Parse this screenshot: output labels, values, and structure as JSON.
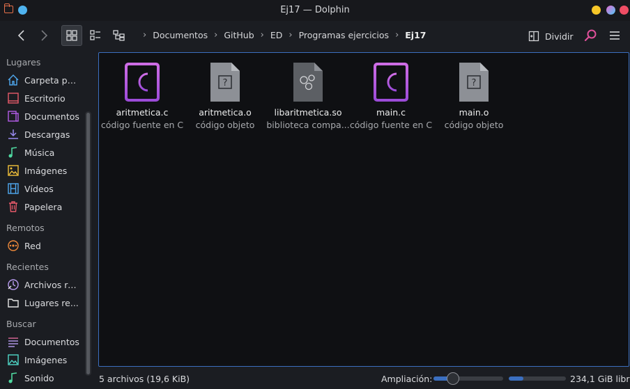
{
  "window": {
    "title": "Ej17 — Dolphin"
  },
  "colors": {
    "accent": "#3b6fc0",
    "c_source_icon": "#c85ce0",
    "folder_icon": "#e5704a"
  },
  "toolbar": {
    "breadcrumb": [
      "Documentos",
      "GitHub",
      "ED",
      "Programas ejercicios",
      "Ej17"
    ],
    "divide_label": "Dividir",
    "icons": [
      "back-arrow-icon",
      "forward-arrow-icon",
      "icons-view-icon",
      "details-view-icon",
      "tree-view-icon",
      "search-icon",
      "hamburger-menu-icon"
    ]
  },
  "sidebar": {
    "sections": [
      {
        "title": "Lugares",
        "items": [
          {
            "label": "Carpeta pe...",
            "icon": "home-icon"
          },
          {
            "label": "Escritorio",
            "icon": "desktop-icon"
          },
          {
            "label": "Documentos",
            "icon": "documents-icon"
          },
          {
            "label": "Descargas",
            "icon": "downloads-icon"
          },
          {
            "label": "Música",
            "icon": "music-icon"
          },
          {
            "label": "Imágenes",
            "icon": "pictures-icon"
          },
          {
            "label": "Vídeos",
            "icon": "videos-icon"
          },
          {
            "label": "Papelera",
            "icon": "trash-icon"
          }
        ]
      },
      {
        "title": "Remotos",
        "items": [
          {
            "label": "Red",
            "icon": "network-icon"
          }
        ]
      },
      {
        "title": "Recientes",
        "items": [
          {
            "label": "Archivos re...",
            "icon": "recent-files-icon"
          },
          {
            "label": "Lugares re...",
            "icon": "recent-places-icon"
          }
        ]
      },
      {
        "title": "Buscar",
        "items": [
          {
            "label": "Documentos",
            "icon": "search-documents-icon"
          },
          {
            "label": "Imágenes",
            "icon": "search-images-icon"
          },
          {
            "label": "Sonido",
            "icon": "search-audio-icon"
          }
        ]
      }
    ]
  },
  "files": [
    {
      "name": "aritmetica.c",
      "type": "código fuente en C",
      "icon": "c-source-icon"
    },
    {
      "name": "aritmetica.o",
      "type": "código objeto",
      "icon": "unknown-file-icon"
    },
    {
      "name": "libaritmetica.so",
      "type": "biblioteca compa...",
      "icon": "shared-library-icon"
    },
    {
      "name": "main.c",
      "type": "código fuente en C",
      "icon": "c-source-icon"
    },
    {
      "name": "main.o",
      "type": "código objeto",
      "icon": "unknown-file-icon"
    }
  ],
  "status": {
    "summary": "5 archivos (19,6 KiB)",
    "zoom_label": "Ampliación:",
    "zoom_level": 0.28,
    "free_space": "234,1 GiB libre",
    "disk_used_fraction": 0.25
  }
}
